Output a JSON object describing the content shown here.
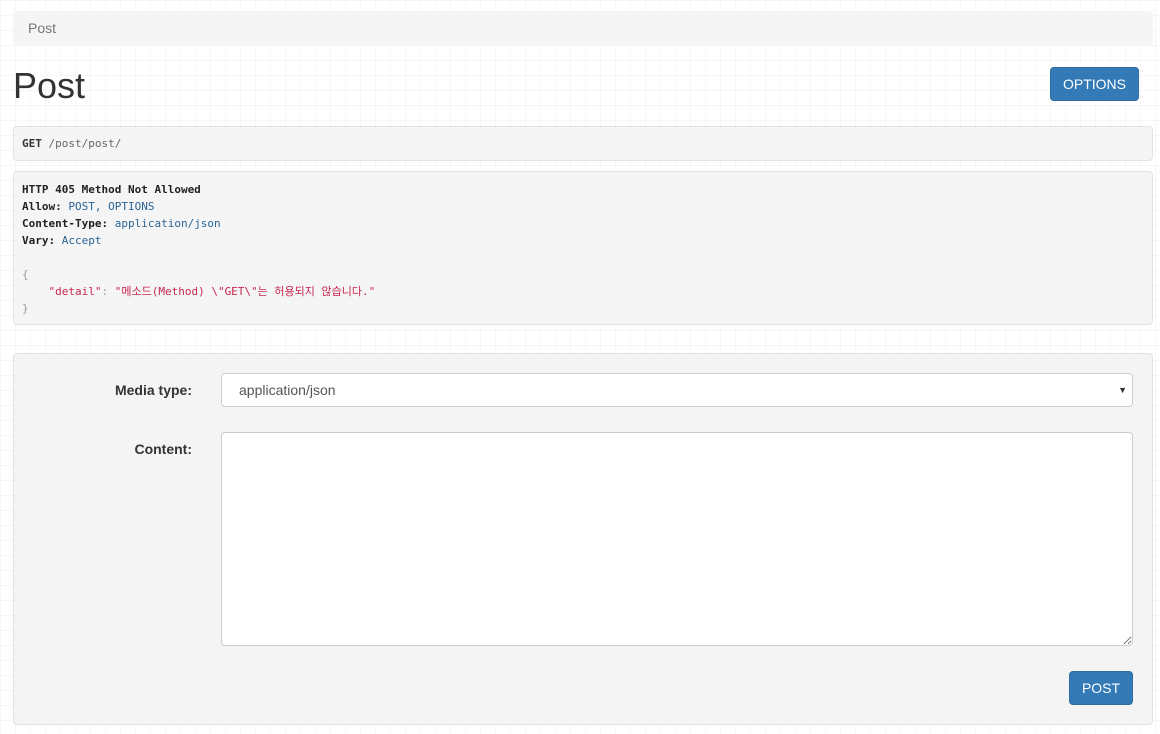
{
  "breadcrumb": {
    "current": "Post"
  },
  "header": {
    "title": "Post",
    "options_label": "OPTIONS"
  },
  "request": {
    "method": "GET",
    "path": "/post/post/"
  },
  "response": {
    "status_line": "HTTP 405 Method Not Allowed",
    "headers": [
      {
        "key": "Allow:",
        "value": "POST, OPTIONS"
      },
      {
        "key": "Content-Type:",
        "value": "application/json"
      },
      {
        "key": "Vary:",
        "value": "Accept"
      }
    ],
    "body": {
      "open_brace": "{",
      "key": "\"detail\"",
      "colon": ": ",
      "value": "\"메소드(Method) \\\"GET\\\"는 허용되지 않습니다.\"",
      "close_brace": "}"
    }
  },
  "form": {
    "media_type_label": "Media type:",
    "media_type_value": "application/json",
    "content_label": "Content:",
    "content_value": "",
    "post_label": "POST"
  },
  "colors": {
    "primary": "#337ab7",
    "panel_bg": "#f5f5f5",
    "json_string": "#c7254e",
    "header_value": "#2a6496"
  }
}
